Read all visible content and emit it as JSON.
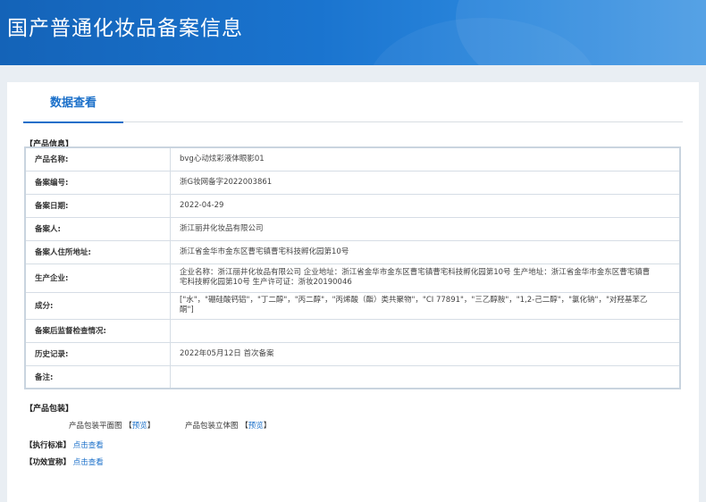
{
  "header": {
    "title": "国产普通化妆品备案信息"
  },
  "tabs": [
    {
      "label": "数据查看"
    }
  ],
  "product_info": {
    "section_title": "【产品信息】",
    "rows": [
      {
        "label": "产品名称:",
        "value": "bvg心动炫彩液体眼影01"
      },
      {
        "label": "备案编号:",
        "value": "浙G妆网备字2022003861"
      },
      {
        "label": "备案日期:",
        "value": "2022-04-29"
      },
      {
        "label": "备案人:",
        "value": "浙江丽井化妆品有限公司"
      },
      {
        "label": "备案人住所地址:",
        "value": "浙江省金华市金东区曹宅镇曹宅科技孵化园第10号"
      },
      {
        "label": "生产企业:",
        "value": "企业名称：浙江丽井化妆品有限公司 企业地址：浙江省金华市金东区曹宅镇曹宅科技孵化园第10号 生产地址：浙江省金华市金东区曹宅镇曹宅科技孵化园第10号 生产许可证：浙妆20190046"
      },
      {
        "label": "成分:",
        "value": "[\"水\"，\"硼硅酸钙铝\"，\"丁二醇\"，\"丙二醇\"，\"丙烯酸（酯）类共聚物\"，\"CI 77891\"，\"三乙醇胺\"，\"1,2-己二醇\"，\"氯化钠\"，\"对羟基苯乙酮\"]"
      },
      {
        "label": "备案后监督检查情况:",
        "value": ""
      },
      {
        "label": "历史记录:",
        "value": "2022年05月12日 首次备案"
      },
      {
        "label": "备注:",
        "value": ""
      }
    ]
  },
  "packaging": {
    "section_title": "【产品包装】",
    "flat_label": "产品包装平面图",
    "flat_link": "预览",
    "solid_label": "产品包装立体图",
    "solid_link": "预览",
    "bracket_open": "【",
    "bracket_close": "】"
  },
  "standard": {
    "label": "【执行标准】",
    "link": "点击查看"
  },
  "efficacy": {
    "label": "【功效宣称】",
    "link": "点击查看"
  },
  "colors": {
    "banner": "#1a6fc9",
    "accent": "#1a6fc9",
    "background": "#e9eef3"
  }
}
